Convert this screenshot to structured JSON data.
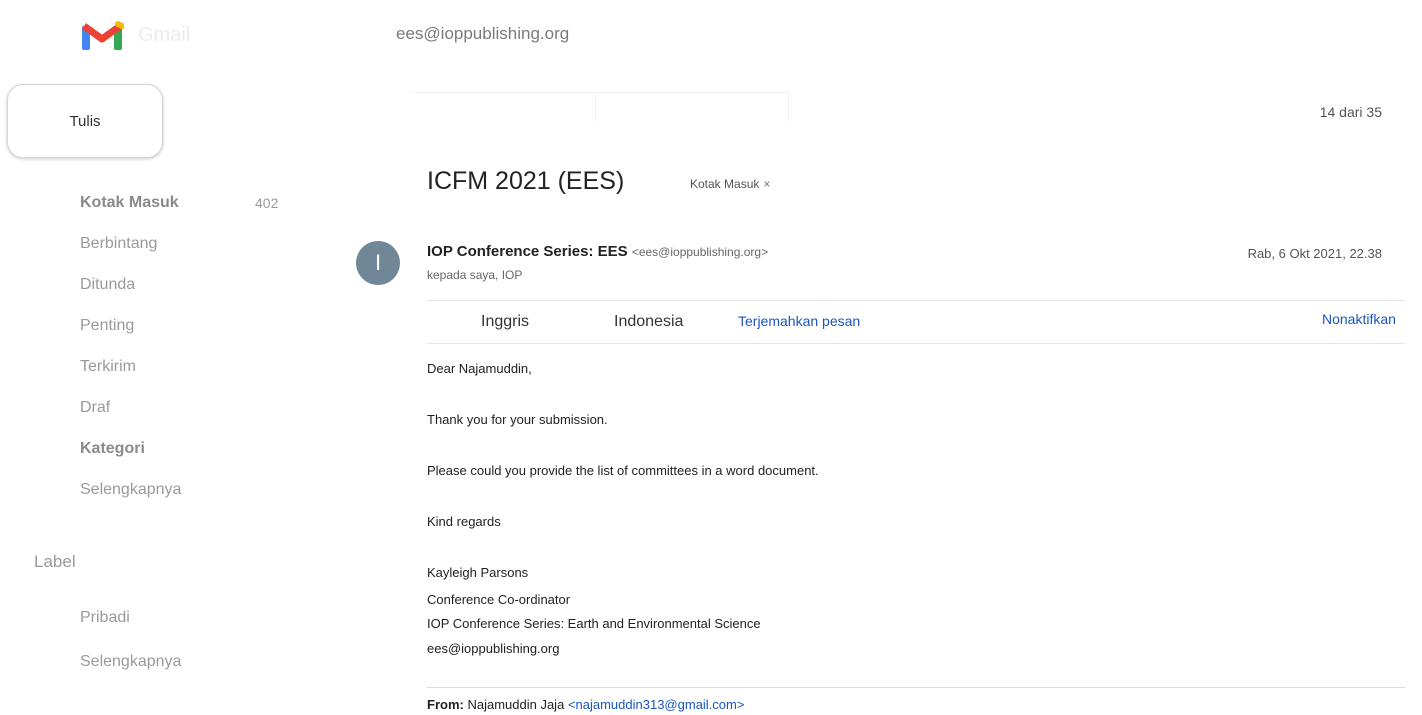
{
  "header": {
    "app_name": "Gmail",
    "search_text": "ees@ioppublishing.org",
    "brand_colors": {
      "red": "#ea4335",
      "blue": "#4285f4",
      "green": "#34a853",
      "yellow": "#fbbc04"
    }
  },
  "compose": {
    "label": "Tulis"
  },
  "sidebar": {
    "items": [
      {
        "label": "Kotak Masuk",
        "count": "402"
      },
      {
        "label": "Berbintang"
      },
      {
        "label": "Ditunda"
      },
      {
        "label": "Penting"
      },
      {
        "label": "Terkirim"
      },
      {
        "label": "Draf"
      },
      {
        "label": "Kategori"
      },
      {
        "label": "Selengkapnya"
      }
    ],
    "labels_heading": "Label",
    "labels": [
      {
        "label": "Pribadi"
      },
      {
        "label": "Selengkapnya"
      }
    ]
  },
  "toolbar": {
    "counter": "14 dari 35"
  },
  "message": {
    "subject": "ICFM 2021 (EES)",
    "label_chip": "Kotak Masuk",
    "label_chip_close": "×",
    "avatar_letter": "I",
    "sender_name": "IOP Conference Series: EES",
    "sender_email": "<ees@ioppublishing.org>",
    "recipients": "kepada saya, IOP",
    "date": "Rab, 6 Okt 2021, 22.38"
  },
  "translate": {
    "lang_from": "Inggris",
    "lang_to": "Indonesia",
    "translate_link": "Terjemahkan pesan",
    "disable_link": "Nonaktifkan"
  },
  "body": {
    "greeting": "Dear Najamuddin,",
    "line1": "Thank you for your submission.",
    "line2": "Please could you provide the list of committees in a word document.",
    "closing": "Kind regards",
    "sig_name": "Kayleigh Parsons",
    "sig_title": "Conference Co-ordinator",
    "sig_org": "IOP Conference Series: Earth and Environmental Science",
    "sig_email": "ees@ioppublishing.org",
    "from_label": "From:",
    "from_name": "Najamuddin Jaja",
    "from_email": "<najamuddin313@gmail.com>"
  }
}
